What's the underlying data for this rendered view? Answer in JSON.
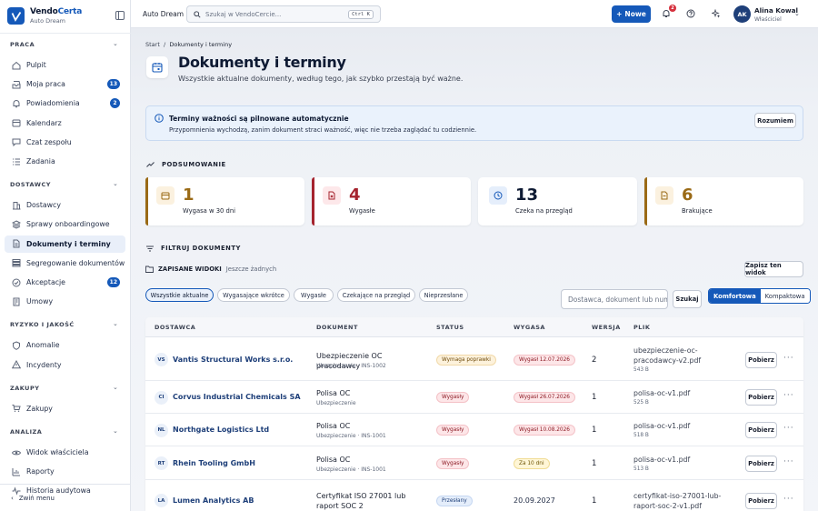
{
  "app": {
    "name_a": "Vendo",
    "name_b": "Certa",
    "subtitle": "Auto Dream"
  },
  "sidebar": {
    "sections": [
      {
        "label": "PRACA",
        "items": [
          {
            "label": "Pulpit",
            "icon": "home-icon"
          },
          {
            "label": "Moja praca",
            "icon": "inbox-icon",
            "badge": "13"
          },
          {
            "label": "Powiadomienia",
            "icon": "bell-icon",
            "badge": "2"
          },
          {
            "label": "Kalendarz",
            "icon": "calendar-icon"
          },
          {
            "label": "Czat zespołu",
            "icon": "chat-icon"
          },
          {
            "label": "Zadania",
            "icon": "list-icon"
          }
        ]
      },
      {
        "label": "DOSTAWCY",
        "items": [
          {
            "label": "Dostawcy",
            "icon": "building-icon"
          },
          {
            "label": "Sprawy onboardingowe",
            "icon": "layers-icon"
          },
          {
            "label": "Dokumenty i terminy",
            "icon": "document-icon",
            "active": true
          },
          {
            "label": "Segregowanie dokumentów",
            "icon": "stack-icon"
          },
          {
            "label": "Akceptacje",
            "icon": "check-icon",
            "badge": "12"
          },
          {
            "label": "Umowy",
            "icon": "contract-icon"
          }
        ]
      },
      {
        "label": "RYZYKO I JAKOŚĆ",
        "items": [
          {
            "label": "Anomalie",
            "icon": "shield-icon"
          },
          {
            "label": "Incydenty",
            "icon": "alert-icon"
          }
        ]
      },
      {
        "label": "ZAKUPY",
        "items": [
          {
            "label": "Zakupy",
            "icon": "cart-icon"
          }
        ]
      },
      {
        "label": "ANALIZA",
        "items": [
          {
            "label": "Widok właściciela",
            "icon": "eye-icon"
          },
          {
            "label": "Raporty",
            "icon": "chart-icon"
          },
          {
            "label": "Historia audytowa",
            "icon": "pulse-icon"
          }
        ]
      }
    ],
    "collapse_label": "Zwiń menu"
  },
  "topbar": {
    "org": "Auto Dream",
    "search_placeholder": "Szukaj w VendoCercie...",
    "search_shortcut": "Ctrl K",
    "new_label": "Nowe",
    "bell_count": "2",
    "user": {
      "initials": "AK",
      "name": "Alina Kowal",
      "role": "Właściciel"
    }
  },
  "page": {
    "breadcrumb_root": "Start",
    "breadcrumb_sep": "/",
    "breadcrumb_current": "Dokumenty i terminy",
    "title": "Dokumenty i terminy",
    "subtitle": "Wszystkie aktualne dokumenty, według tego, jak szybko przestają być ważne."
  },
  "banner": {
    "title": "Terminy ważności są pilnowane automatycznie",
    "text": "Przypomnienia wychodzą, zanim dokument straci ważność, więc nie trzeba zaglądać tu codziennie.",
    "button": "Rozumiem"
  },
  "summary": {
    "heading": "PODSUMOWANIE",
    "cards": [
      {
        "value": "1",
        "label": "Wygasa w 30 dni",
        "color": "#9a6a16",
        "bg": "#fbf1df",
        "icon": "calendar-icon"
      },
      {
        "value": "4",
        "label": "Wygasłe",
        "color": "#a5232e",
        "bg": "#fde8ea",
        "icon": "file-x-icon"
      },
      {
        "value": "13",
        "label": "Czeka na przegląd",
        "color": "#1559b9",
        "bg": "#e5eefb",
        "icon": "clock-icon"
      },
      {
        "value": "6",
        "label": "Brakujące",
        "color": "#9a6a16",
        "bg": "#fbf1df",
        "icon": "file-icon"
      }
    ]
  },
  "filters": {
    "heading": "FILTRUJ DOKUMENTY",
    "saved_label": "ZAPISANE WIDOKI",
    "saved_empty": "Jeszcze żadnych",
    "save_view": "Zapisz ten widok",
    "chips": [
      "Wszystkie aktualne",
      "Wygasające wkrótce",
      "Wygasłe",
      "Czekające na przegląd",
      "Nieprzesłane"
    ],
    "search_placeholder": "Dostawca, dokument lub numer",
    "search_button": "Szukaj",
    "density": [
      "Komfortowa",
      "Kompaktowa"
    ]
  },
  "table": {
    "columns": [
      "DOSTAWCA",
      "DOKUMENT",
      "STATUS",
      "WYGASA",
      "WERSJA",
      "PLIK"
    ],
    "download_label": "Pobierz",
    "rows": [
      {
        "initials": "VS",
        "vendor": "Vantis Structural Works s.r.o.",
        "doc": "Ubezpieczenie OC pracodawcy",
        "meta": "Ubezpieczenie · INS-1002",
        "status": "Wymaga poprawki",
        "status_kind": "warn",
        "expires": "Wygasł 12.07.2026",
        "exp_kind": "red",
        "version": "2",
        "file": "ubezpieczenie-oc-pracodawcy-v2.pdf",
        "size": "543 B"
      },
      {
        "initials": "CI",
        "vendor": "Corvus Industrial Chemicals SA",
        "doc": "Polisa OC",
        "meta": "Ubezpieczenie",
        "status": "Wygasły",
        "status_kind": "red",
        "expires": "Wygasł 26.07.2026",
        "exp_kind": "red",
        "version": "1",
        "file": "polisa-oc-v1.pdf",
        "size": "525 B"
      },
      {
        "initials": "NL",
        "vendor": "Northgate Logistics Ltd",
        "doc": "Polisa OC",
        "meta": "Ubezpieczenie · INS-1001",
        "status": "Wygasły",
        "status_kind": "red",
        "expires": "Wygasł 10.08.2026",
        "exp_kind": "red",
        "version": "1",
        "file": "polisa-oc-v1.pdf",
        "size": "518 B"
      },
      {
        "initials": "RT",
        "vendor": "Rhein Tooling GmbH",
        "doc": "Polisa OC",
        "meta": "Ubezpieczenie · INS-1001",
        "status": "Wygasły",
        "status_kind": "red",
        "expires": "Za 10 dni",
        "exp_kind": "yel",
        "version": "1",
        "file": "polisa-oc-v1.pdf",
        "size": "513 B"
      },
      {
        "initials": "LA",
        "vendor": "Lumen Analytics AB",
        "doc": "Certyfikat ISO 27001 lub raport SOC 2",
        "meta": "",
        "status": "Przesłany",
        "status_kind": "blue",
        "expires": "20.09.2027",
        "exp_kind": "plain",
        "version": "1",
        "file": "certyfikat-iso-27001-lub-raport-soc-2-v1.pdf",
        "size": ""
      }
    ]
  }
}
